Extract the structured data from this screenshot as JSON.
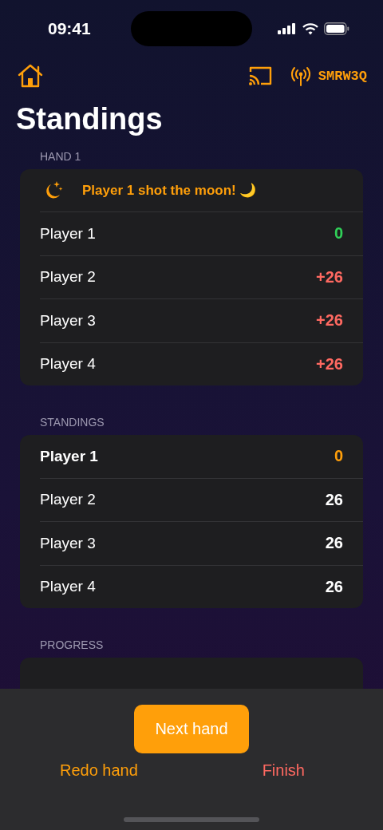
{
  "status_bar": {
    "time": "09:41"
  },
  "toolbar": {
    "room_code": "SMRW3Q"
  },
  "title": "Standings",
  "hand": {
    "header": "HAND 1",
    "banner": "Player 1 shot the moon! 🌙",
    "rows": [
      {
        "name": "Player 1",
        "score": "0",
        "color": "#30d158"
      },
      {
        "name": "Player 2",
        "score": "+26",
        "color": "#ff6961"
      },
      {
        "name": "Player 3",
        "score": "+26",
        "color": "#ff6961"
      },
      {
        "name": "Player 4",
        "score": "+26",
        "color": "#ff6961"
      }
    ]
  },
  "standings": {
    "header": "STANDINGS",
    "rows": [
      {
        "name": "Player 1",
        "score": "0",
        "leader": true
      },
      {
        "name": "Player 2",
        "score": "26",
        "leader": false
      },
      {
        "name": "Player 3",
        "score": "26",
        "leader": false
      },
      {
        "name": "Player 4",
        "score": "26",
        "leader": false
      }
    ]
  },
  "progress": {
    "header": "PROGRESS"
  },
  "actions": {
    "primary": "Next hand",
    "redo": "Redo hand",
    "finish": "Finish"
  }
}
